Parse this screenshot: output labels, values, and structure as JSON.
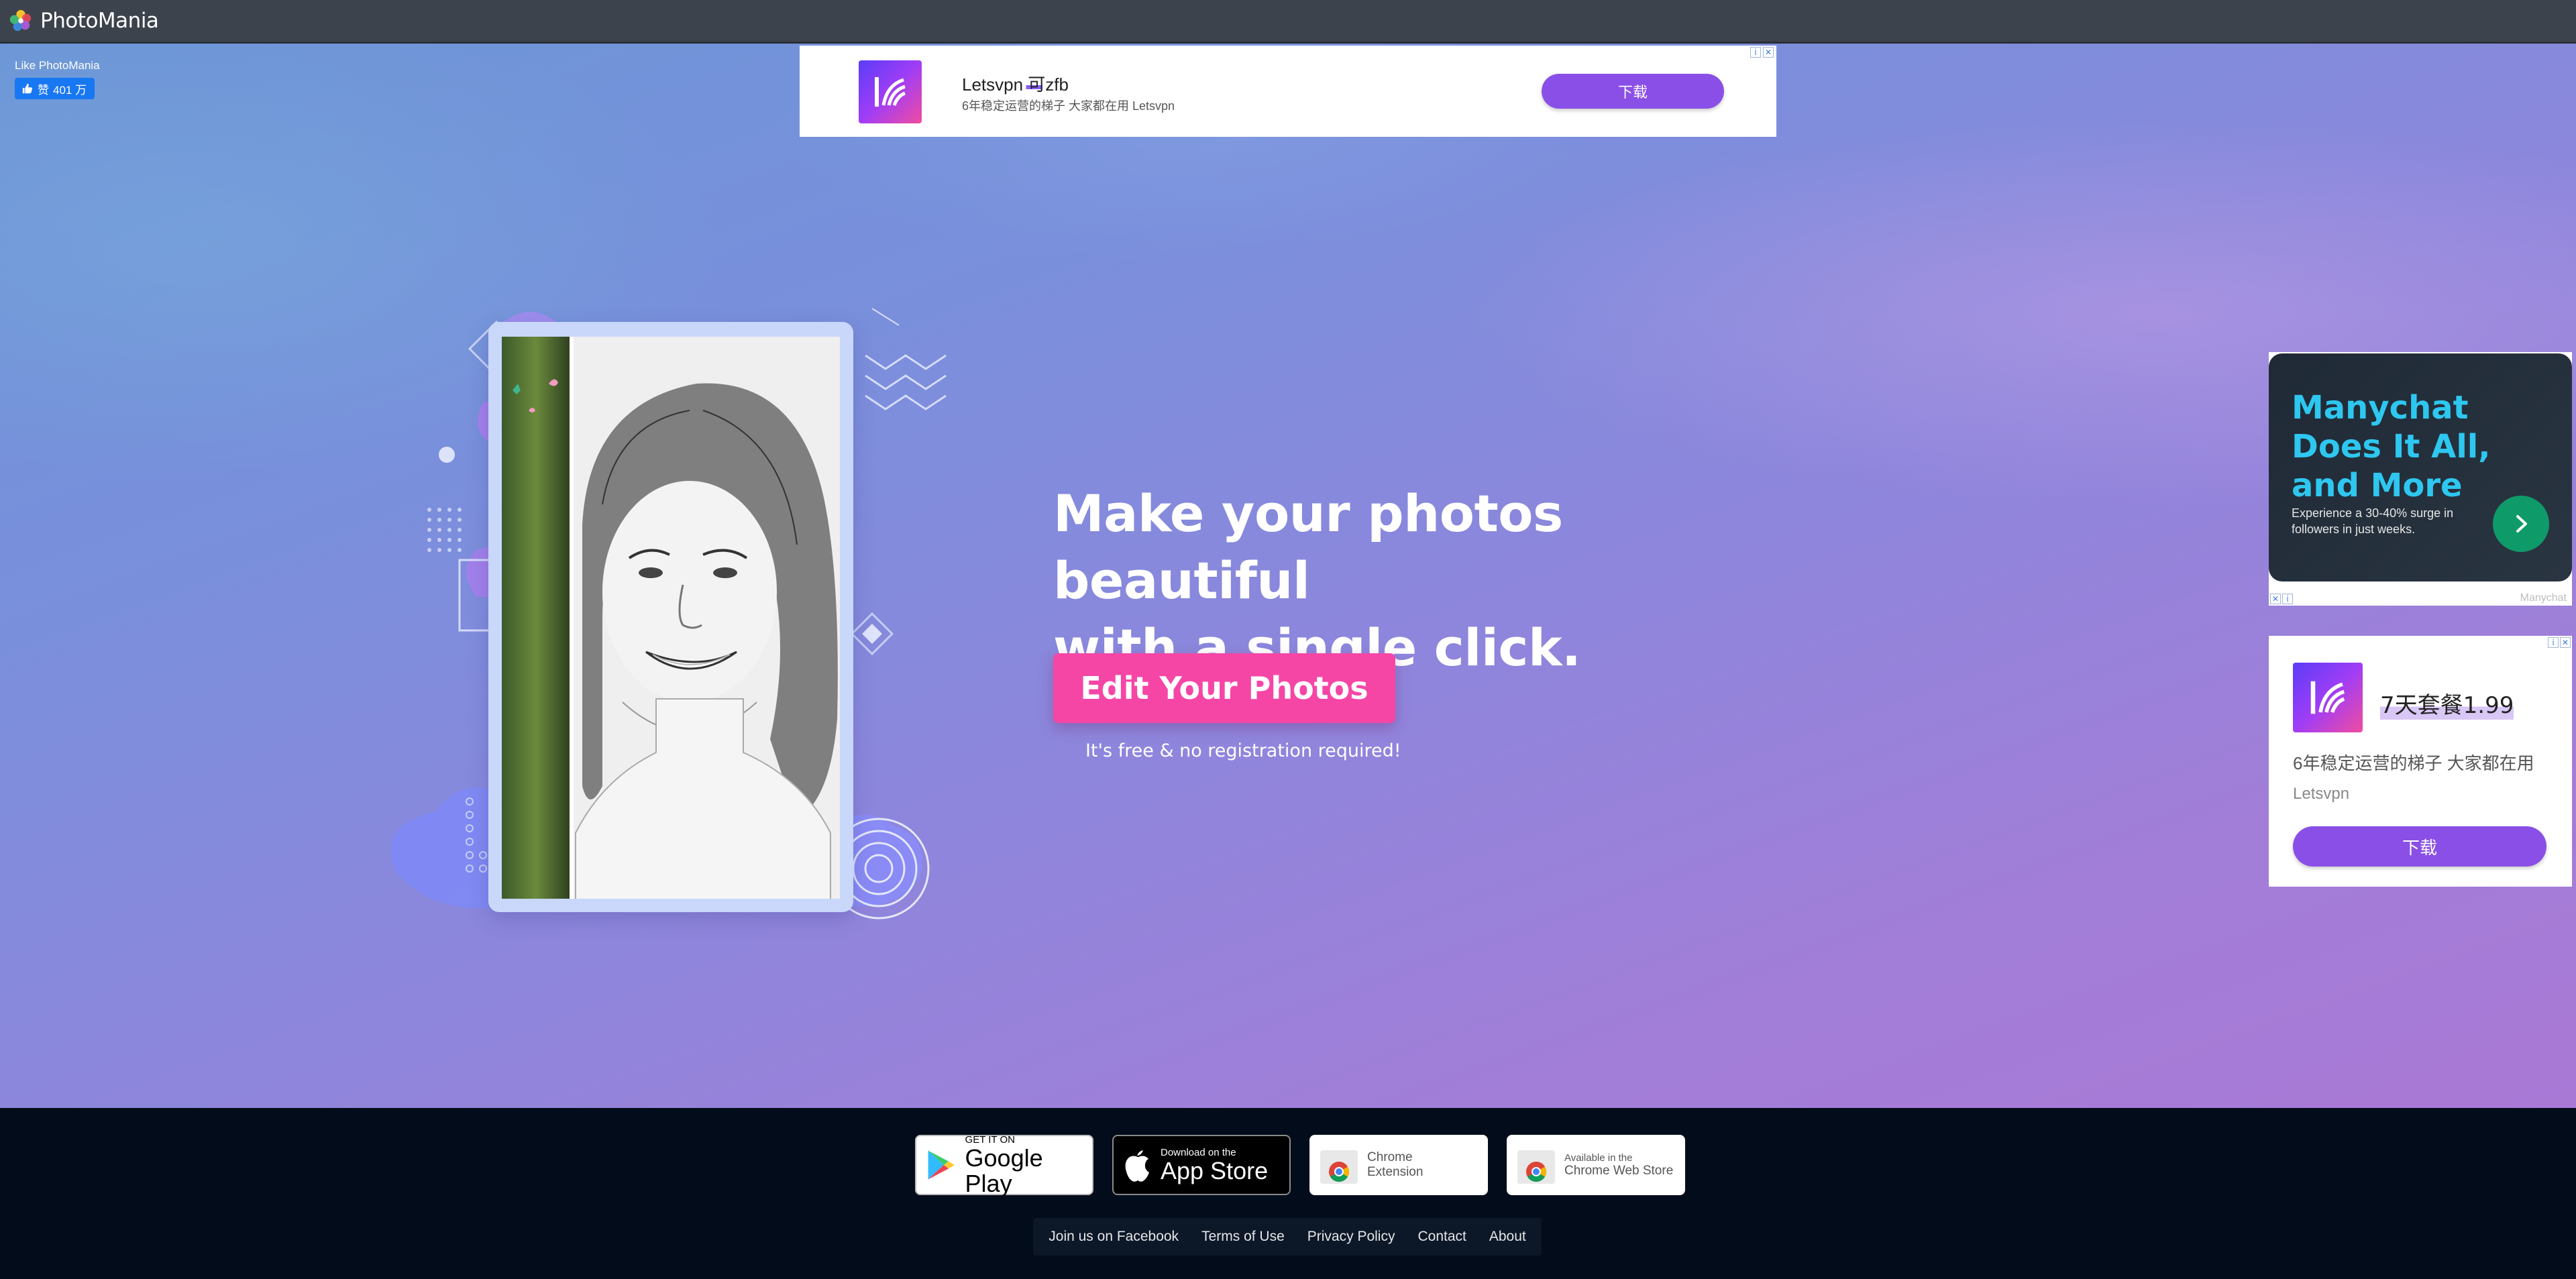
{
  "topbar": {
    "logo_text": "PhotoMania"
  },
  "facebook": {
    "like_title": "Like PhotoMania",
    "like_label": "赞",
    "like_count": "401 万"
  },
  "ads": {
    "top": {
      "title": "Letsvpn 可zfb",
      "subtitle": "6年稳定运营的梯子 大家都在用 Letsvpn",
      "button": "下载",
      "close": "✕",
      "info": "i"
    },
    "right1": {
      "title": "Manychat Does It All, and More",
      "subtitle": "Experience a 30-40% surge in followers in just weeks.",
      "brand": "Manychat",
      "close": "✕",
      "info": "i"
    },
    "right2": {
      "title": "7天套餐1.99",
      "subtitle": "6年稳定运营的梯子 大家都在用",
      "brand": "Letsvpn",
      "button": "下载",
      "close": "✕",
      "info": "i"
    }
  },
  "hero": {
    "headline_line1": "Make your photos beautiful",
    "headline_line2": "with a single click.",
    "cta": "Edit Your Photos",
    "note": "It's free & no registration required!"
  },
  "footer": {
    "badges": {
      "google_play": {
        "small": "GET IT ON",
        "big": "Google Play"
      },
      "app_store": {
        "small": "Download on the",
        "big": "App Store"
      },
      "chrome_ext": {
        "line1": "Chrome",
        "line2": "Extension"
      },
      "chrome_store": {
        "line1": "Available in the",
        "line2": "Chrome Web Store"
      }
    },
    "links": [
      "Join us on Facebook",
      "Terms of Use",
      "Privacy Policy",
      "Contact",
      "About"
    ]
  },
  "colors": {
    "cta": "#f546a6",
    "ad_button": "#8a4fe6",
    "fb": "#1877f2",
    "footer_bg": "#020c1b"
  }
}
